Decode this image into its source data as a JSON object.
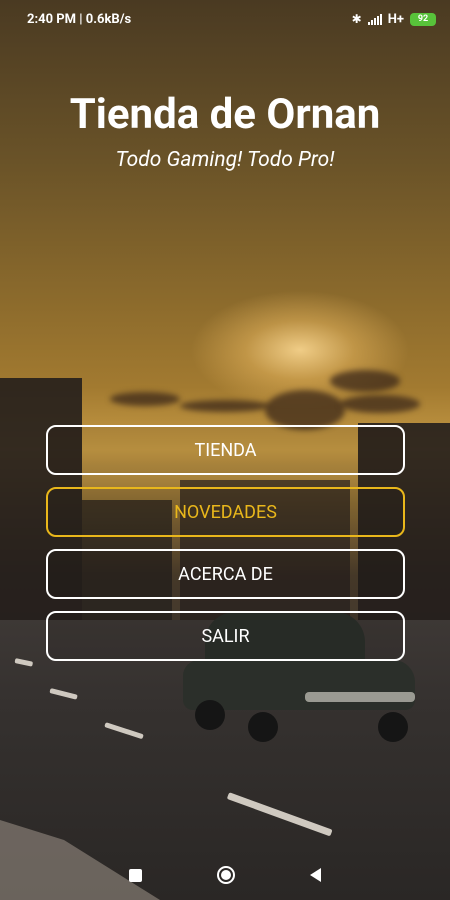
{
  "status_bar": {
    "time_speed": "2:40 PM | 0.6kB/s",
    "network": "H+",
    "battery": "92"
  },
  "header": {
    "title": "Tienda de Ornan",
    "subtitle": "Todo Gaming! Todo Pro!"
  },
  "menu": {
    "items": [
      {
        "label": "TIENDA"
      },
      {
        "label": "NOVEDADES"
      },
      {
        "label": "ACERCA DE"
      },
      {
        "label": "SALIR"
      }
    ],
    "active_color": "#e9b71b"
  },
  "nav_bar": {
    "icons": [
      "recents-icon",
      "home-icon",
      "back-icon"
    ]
  }
}
